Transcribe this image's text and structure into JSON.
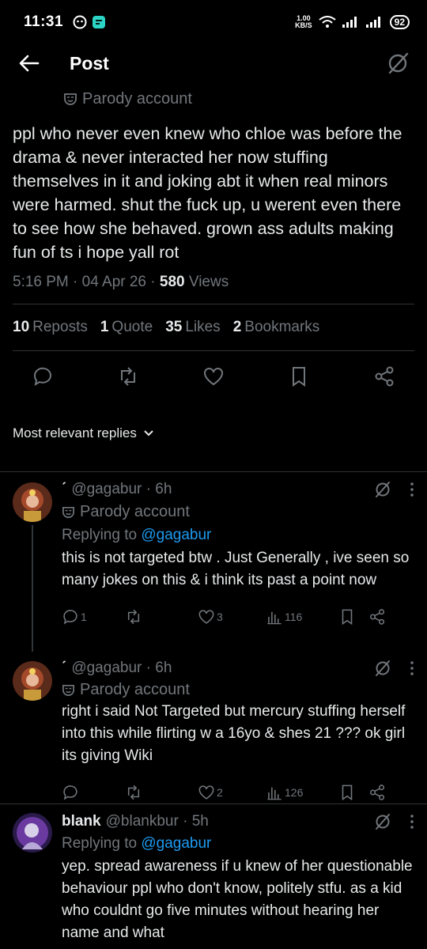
{
  "status_bar": {
    "time": "11:31",
    "net_speed_value": "1.00",
    "net_speed_unit": "KB/S",
    "battery": "92"
  },
  "header": {
    "title": "Post"
  },
  "main_tweet": {
    "parody_label": "Parody account",
    "text": "ppl who never even knew who chloe was before the drama & never interacted her now stuffing themselves in it and joking abt it when real minors were harmed. shut the fuck up, u werent even there to see how she behaved. grown ass adults making fun of ts i hope yall rot",
    "time": "5:16 PM",
    "date": "04 Apr 26",
    "views_count": "580",
    "views_label": "Views",
    "stats": [
      {
        "count": "10",
        "label": "Reposts"
      },
      {
        "count": "1",
        "label": "Quote"
      },
      {
        "count": "35",
        "label": "Likes"
      },
      {
        "count": "2",
        "label": "Bookmarks"
      }
    ]
  },
  "sort": {
    "label": "Most relevant replies"
  },
  "replies": [
    {
      "name": "ˊ",
      "handle": "@gagabur",
      "age": "6h",
      "parody_label": "Parody account",
      "replying_prefix": "Replying to",
      "replying_to": "@gagabur",
      "text": "this is not targeted btw . Just Generally , ive seen so many jokes on this & i think its past a point now",
      "replies": "1",
      "reposts": "",
      "likes": "3",
      "views": "116"
    },
    {
      "name": "ˊ",
      "handle": "@gagabur",
      "age": "6h",
      "parody_label": "Parody account",
      "text": "right i said Not Targeted but mercury stuffing herself into this while flirting w a 16yo & shes 21 ??? ok girl its giving Wiki",
      "replies": "",
      "reposts": "",
      "likes": "2",
      "views": "126"
    },
    {
      "name": "blank",
      "handle": "@blankbur",
      "age": "5h",
      "replying_prefix": "Replying to",
      "replying_to": "@gagabur",
      "text": "yep. spread awareness if u knew of her questionable behaviour ppl who don't know, politely stfu. as a kid who couldnt go five minutes without hearing her name and what"
    }
  ],
  "colors": {
    "background": "#000000",
    "text": "#e7e9ea",
    "muted": "#71767b",
    "link": "#1d9bf0",
    "divider": "#2f3336"
  }
}
